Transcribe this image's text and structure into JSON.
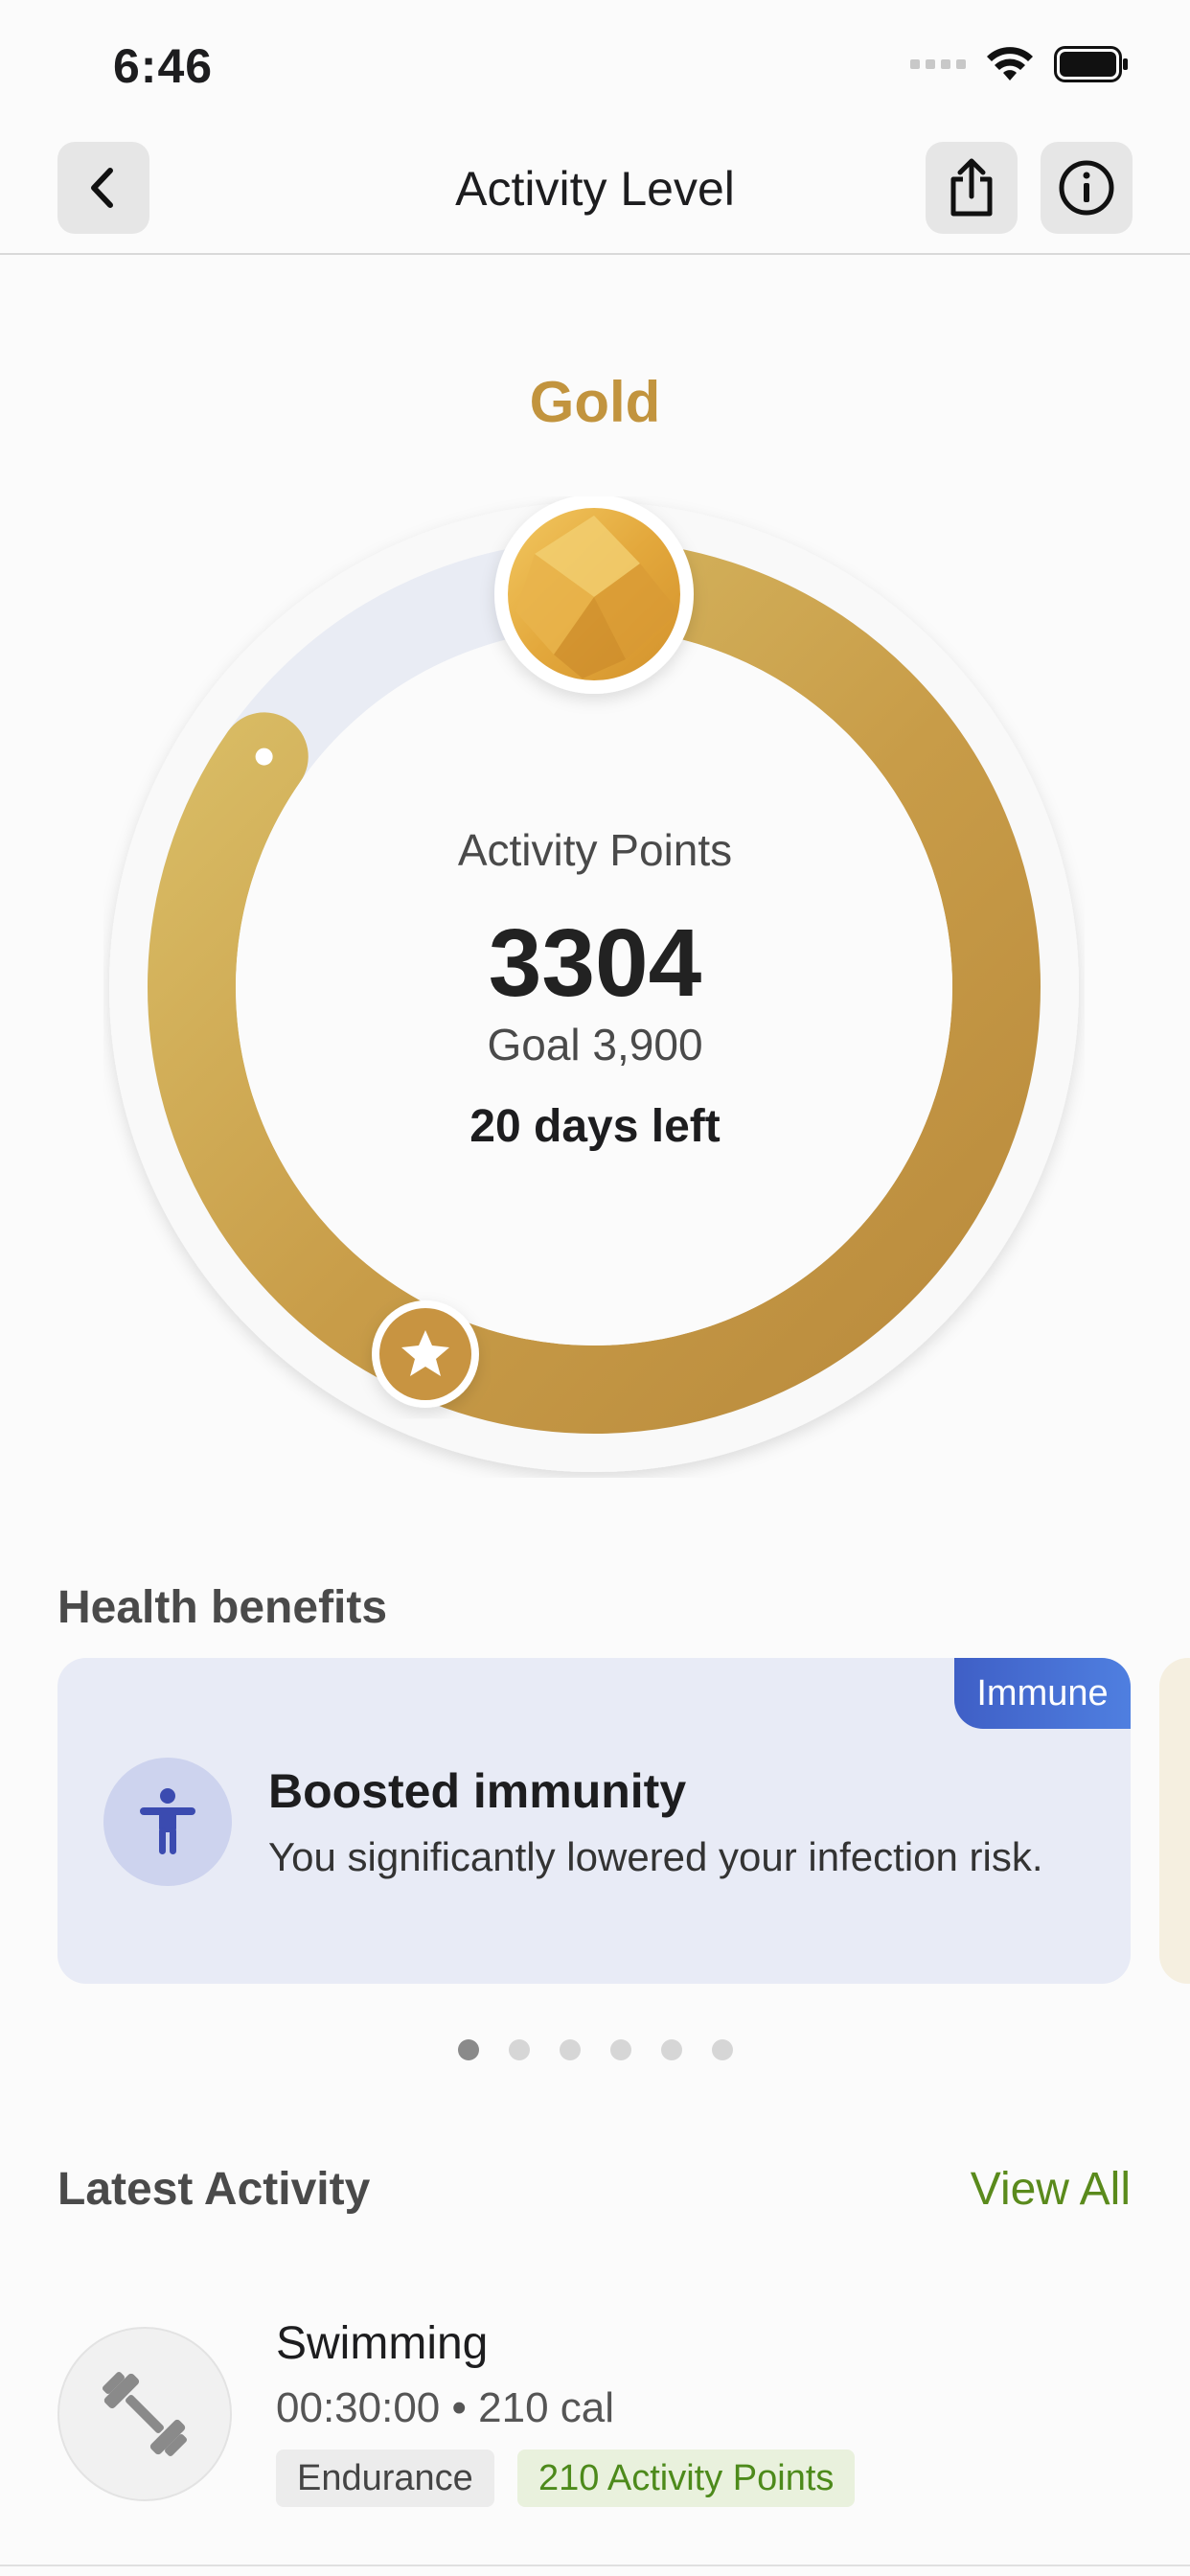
{
  "status_bar": {
    "time": "6:46"
  },
  "nav": {
    "title": "Activity Level",
    "back_icon": "chevron-left-icon",
    "share_icon": "share-icon",
    "info_icon": "info-icon"
  },
  "level": {
    "name": "Gold",
    "accent_color": "#c2943e",
    "progress_fraction": 0.847,
    "points_label": "Activity Points",
    "points": "3304",
    "goal": "Goal 3,900",
    "days_left": "20 days left"
  },
  "health_benefits": {
    "title": "Health benefits",
    "cards": [
      {
        "tag": "Immune",
        "title": "Boosted immunity",
        "description": "You significantly lowered your infection risk.",
        "icon": "person-icon",
        "color": "#e8ebf6"
      }
    ],
    "page_count": 6,
    "active_page": 0
  },
  "latest_activity": {
    "title": "Latest Activity",
    "view_all": "View All",
    "items": [
      {
        "name": "Swimming",
        "meta": "00:30:00 • 210 cal",
        "category": "Endurance",
        "points": "210 Activity Points",
        "icon": "dumbbell-icon"
      }
    ]
  }
}
